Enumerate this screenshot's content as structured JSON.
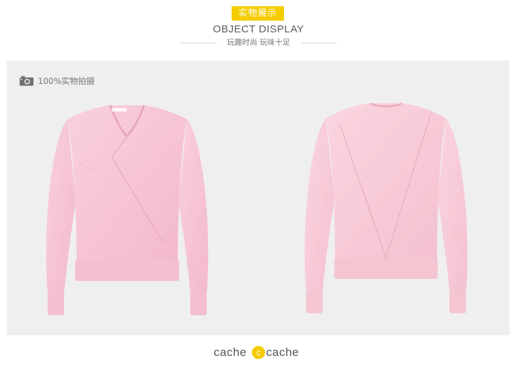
{
  "header": {
    "badge_cn": "实物展示",
    "title_en": "OBJECT DISPLAY",
    "subtitle": "玩趣时尚 玩味十足"
  },
  "panel": {
    "real_shot_label": "100%实物拍摄",
    "background": "#efefef",
    "garment_color": "#f7c6d4"
  },
  "brand": {
    "word_left": "cache",
    "logo_letter": "c",
    "word_right": "cache",
    "logo_color": "#f5cc00"
  },
  "colors": {
    "accent": "#f5cc00"
  }
}
